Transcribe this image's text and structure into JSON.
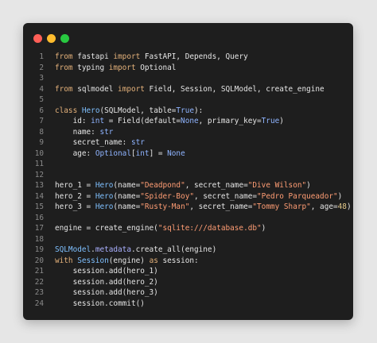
{
  "window": {
    "traffic_lights": {
      "close_color": "#ff5f57",
      "minimize_color": "#febc2e",
      "maximize_color": "#28c840"
    }
  },
  "code": {
    "lines": [
      {
        "num": "1",
        "segments": [
          {
            "t": "from",
            "c": "kw"
          },
          {
            "t": " fastapi ",
            "c": "plain"
          },
          {
            "t": "import",
            "c": "kw"
          },
          {
            "t": " FastAPI, Depends, Query",
            "c": "plain"
          }
        ]
      },
      {
        "num": "2",
        "segments": [
          {
            "t": "from",
            "c": "kw"
          },
          {
            "t": " typing ",
            "c": "plain"
          },
          {
            "t": "import",
            "c": "kw"
          },
          {
            "t": " Optional",
            "c": "plain"
          }
        ]
      },
      {
        "num": "3",
        "segments": []
      },
      {
        "num": "4",
        "segments": [
          {
            "t": "from",
            "c": "kw"
          },
          {
            "t": " sqlmodel ",
            "c": "plain"
          },
          {
            "t": "import",
            "c": "kw"
          },
          {
            "t": " Field, Session, SQLModel, create_engine",
            "c": "plain"
          }
        ]
      },
      {
        "num": "5",
        "segments": []
      },
      {
        "num": "6",
        "segments": [
          {
            "t": "class",
            "c": "kw"
          },
          {
            "t": " ",
            "c": "plain"
          },
          {
            "t": "Hero",
            "c": "cls"
          },
          {
            "t": "(SQLModel, table=",
            "c": "plain"
          },
          {
            "t": "True",
            "c": "ty"
          },
          {
            "t": "):",
            "c": "plain"
          }
        ]
      },
      {
        "num": "7",
        "segments": [
          {
            "t": "    id: ",
            "c": "plain"
          },
          {
            "t": "int",
            "c": "ty"
          },
          {
            "t": " = Field(default=",
            "c": "plain"
          },
          {
            "t": "None",
            "c": "ty"
          },
          {
            "t": ", primary_key=",
            "c": "plain"
          },
          {
            "t": "True",
            "c": "ty"
          },
          {
            "t": ")",
            "c": "plain"
          }
        ]
      },
      {
        "num": "8",
        "segments": [
          {
            "t": "    name: ",
            "c": "plain"
          },
          {
            "t": "str",
            "c": "ty"
          }
        ]
      },
      {
        "num": "9",
        "segments": [
          {
            "t": "    secret_name: ",
            "c": "plain"
          },
          {
            "t": "str",
            "c": "ty"
          }
        ]
      },
      {
        "num": "10",
        "segments": [
          {
            "t": "    age: ",
            "c": "plain"
          },
          {
            "t": "Optional",
            "c": "ty"
          },
          {
            "t": "[",
            "c": "plain"
          },
          {
            "t": "int",
            "c": "ty"
          },
          {
            "t": "] = ",
            "c": "plain"
          },
          {
            "t": "None",
            "c": "ty"
          }
        ]
      },
      {
        "num": "11",
        "segments": []
      },
      {
        "num": "12",
        "segments": []
      },
      {
        "num": "13",
        "segments": [
          {
            "t": "hero_1 = ",
            "c": "plain"
          },
          {
            "t": "Hero",
            "c": "cls"
          },
          {
            "t": "(name=",
            "c": "plain"
          },
          {
            "t": "\"Deadpond\"",
            "c": "str"
          },
          {
            "t": ", secret_name=",
            "c": "plain"
          },
          {
            "t": "\"Dive Wilson\"",
            "c": "str"
          },
          {
            "t": ")",
            "c": "plain"
          }
        ]
      },
      {
        "num": "14",
        "segments": [
          {
            "t": "hero_2 = ",
            "c": "plain"
          },
          {
            "t": "Hero",
            "c": "cls"
          },
          {
            "t": "(name=",
            "c": "plain"
          },
          {
            "t": "\"Spider-Boy\"",
            "c": "str"
          },
          {
            "t": ", secret_name=",
            "c": "plain"
          },
          {
            "t": "\"Pedro Parqueador\"",
            "c": "str"
          },
          {
            "t": ")",
            "c": "plain"
          }
        ]
      },
      {
        "num": "15",
        "segments": [
          {
            "t": "hero_3 = ",
            "c": "plain"
          },
          {
            "t": "Hero",
            "c": "cls"
          },
          {
            "t": "(name=",
            "c": "plain"
          },
          {
            "t": "\"Rusty-Man\"",
            "c": "str"
          },
          {
            "t": ", secret_name=",
            "c": "plain"
          },
          {
            "t": "\"Tommy Sharp\"",
            "c": "str"
          },
          {
            "t": ", age=",
            "c": "plain"
          },
          {
            "t": "48",
            "c": "num"
          },
          {
            "t": ")",
            "c": "plain"
          }
        ]
      },
      {
        "num": "16",
        "segments": []
      },
      {
        "num": "17",
        "segments": [
          {
            "t": "engine = create_engine(",
            "c": "plain"
          },
          {
            "t": "\"sqlite:///database.db\"",
            "c": "str"
          },
          {
            "t": ")",
            "c": "plain"
          }
        ]
      },
      {
        "num": "18",
        "segments": []
      },
      {
        "num": "19",
        "segments": [
          {
            "t": "SQLModel",
            "c": "cls"
          },
          {
            "t": ".",
            "c": "plain"
          },
          {
            "t": "metadata",
            "c": "attr"
          },
          {
            "t": ".create_all(engine)",
            "c": "plain"
          }
        ]
      },
      {
        "num": "20",
        "segments": [
          {
            "t": "with",
            "c": "kw"
          },
          {
            "t": " ",
            "c": "plain"
          },
          {
            "t": "Session",
            "c": "cls"
          },
          {
            "t": "(engine) ",
            "c": "plain"
          },
          {
            "t": "as",
            "c": "kw"
          },
          {
            "t": " session:",
            "c": "plain"
          }
        ]
      },
      {
        "num": "21",
        "segments": [
          {
            "t": "    session.add(hero_1)",
            "c": "plain"
          }
        ]
      },
      {
        "num": "22",
        "segments": [
          {
            "t": "    session.add(hero_2)",
            "c": "plain"
          }
        ]
      },
      {
        "num": "23",
        "segments": [
          {
            "t": "    session.add(hero_3)",
            "c": "plain"
          }
        ]
      },
      {
        "num": "24",
        "segments": [
          {
            "t": "    session.commit()",
            "c": "plain"
          }
        ]
      }
    ]
  }
}
